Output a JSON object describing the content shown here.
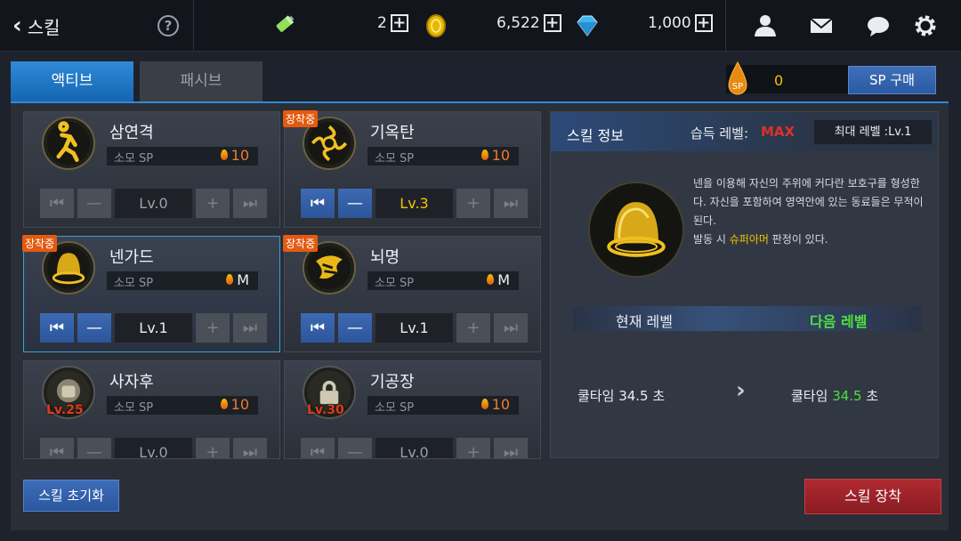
{
  "header": {
    "back_label": "스킬",
    "help_label": "?",
    "currencies": [
      {
        "icon": "battery-icon",
        "value": ""
      },
      {
        "icon": "gold-coin-icon",
        "value": "2"
      },
      {
        "icon": "gem-icon",
        "value": "6,522"
      },
      {
        "icon": "",
        "value": "1,000"
      }
    ],
    "icons": [
      "friend-icon",
      "mail-icon",
      "chat-icon",
      "settings-icon"
    ]
  },
  "tabs": {
    "active": "액티브",
    "passive": "패시브"
  },
  "sp": {
    "value": "0",
    "buy_label": "SP 구매",
    "drop_label": "SP"
  },
  "skills": [
    {
      "name": "삼연격",
      "sp_label": "소모 SP",
      "sp": "10",
      "level": "Lv.0",
      "equipped": "",
      "lock": ""
    },
    {
      "name": "기옥탄",
      "sp_label": "소모 SP",
      "sp": "10",
      "level": "Lv.3",
      "equipped": "장착중",
      "lock": ""
    },
    {
      "name": "넨가드",
      "sp_label": "소모 SP",
      "sp": "M",
      "level": "Lv.1",
      "equipped": "장착중",
      "lock": ""
    },
    {
      "name": "뇌명",
      "sp_label": "소모 SP",
      "sp": "M",
      "level": "Lv.1",
      "equipped": "장착중",
      "lock": ""
    },
    {
      "name": "사자후",
      "sp_label": "소모 SP",
      "sp": "10",
      "level": "Lv.0",
      "equipped": "",
      "lock": "Lv.25"
    },
    {
      "name": "기공장",
      "sp_label": "소모 SP",
      "sp": "10",
      "level": "Lv.0",
      "equipped": "",
      "lock": "Lv.30"
    }
  ],
  "info": {
    "title": "스킬 정보",
    "learn_label": "습득 레벨:",
    "learn_value": "MAX",
    "max_level": "최대 레벨 :Lv.1",
    "desc_1": "넨을 이용해 자신의 주위에 커다란 보호구를 형성한다. 자신을 포함하여 영역안에 있는 동료들은 무적이 된다.",
    "desc_2_pre": "발동 시 ",
    "desc_2_hl": "슈퍼아머",
    "desc_2_post": " 판정이 있다.",
    "current_level_label": "현재 레벨",
    "next_level_label": "다음 레벨",
    "cool_label": "쿨타임",
    "cool_current": "34.5",
    "cool_next": "34.5",
    "cool_unit": "초"
  },
  "buttons": {
    "reset": "스킬 초기화",
    "equip": "스킬 장착"
  },
  "colors": {
    "accent": "#2f8ad8",
    "gold": "#f5c400",
    "red": "#e0302a",
    "green": "#4ee040"
  }
}
